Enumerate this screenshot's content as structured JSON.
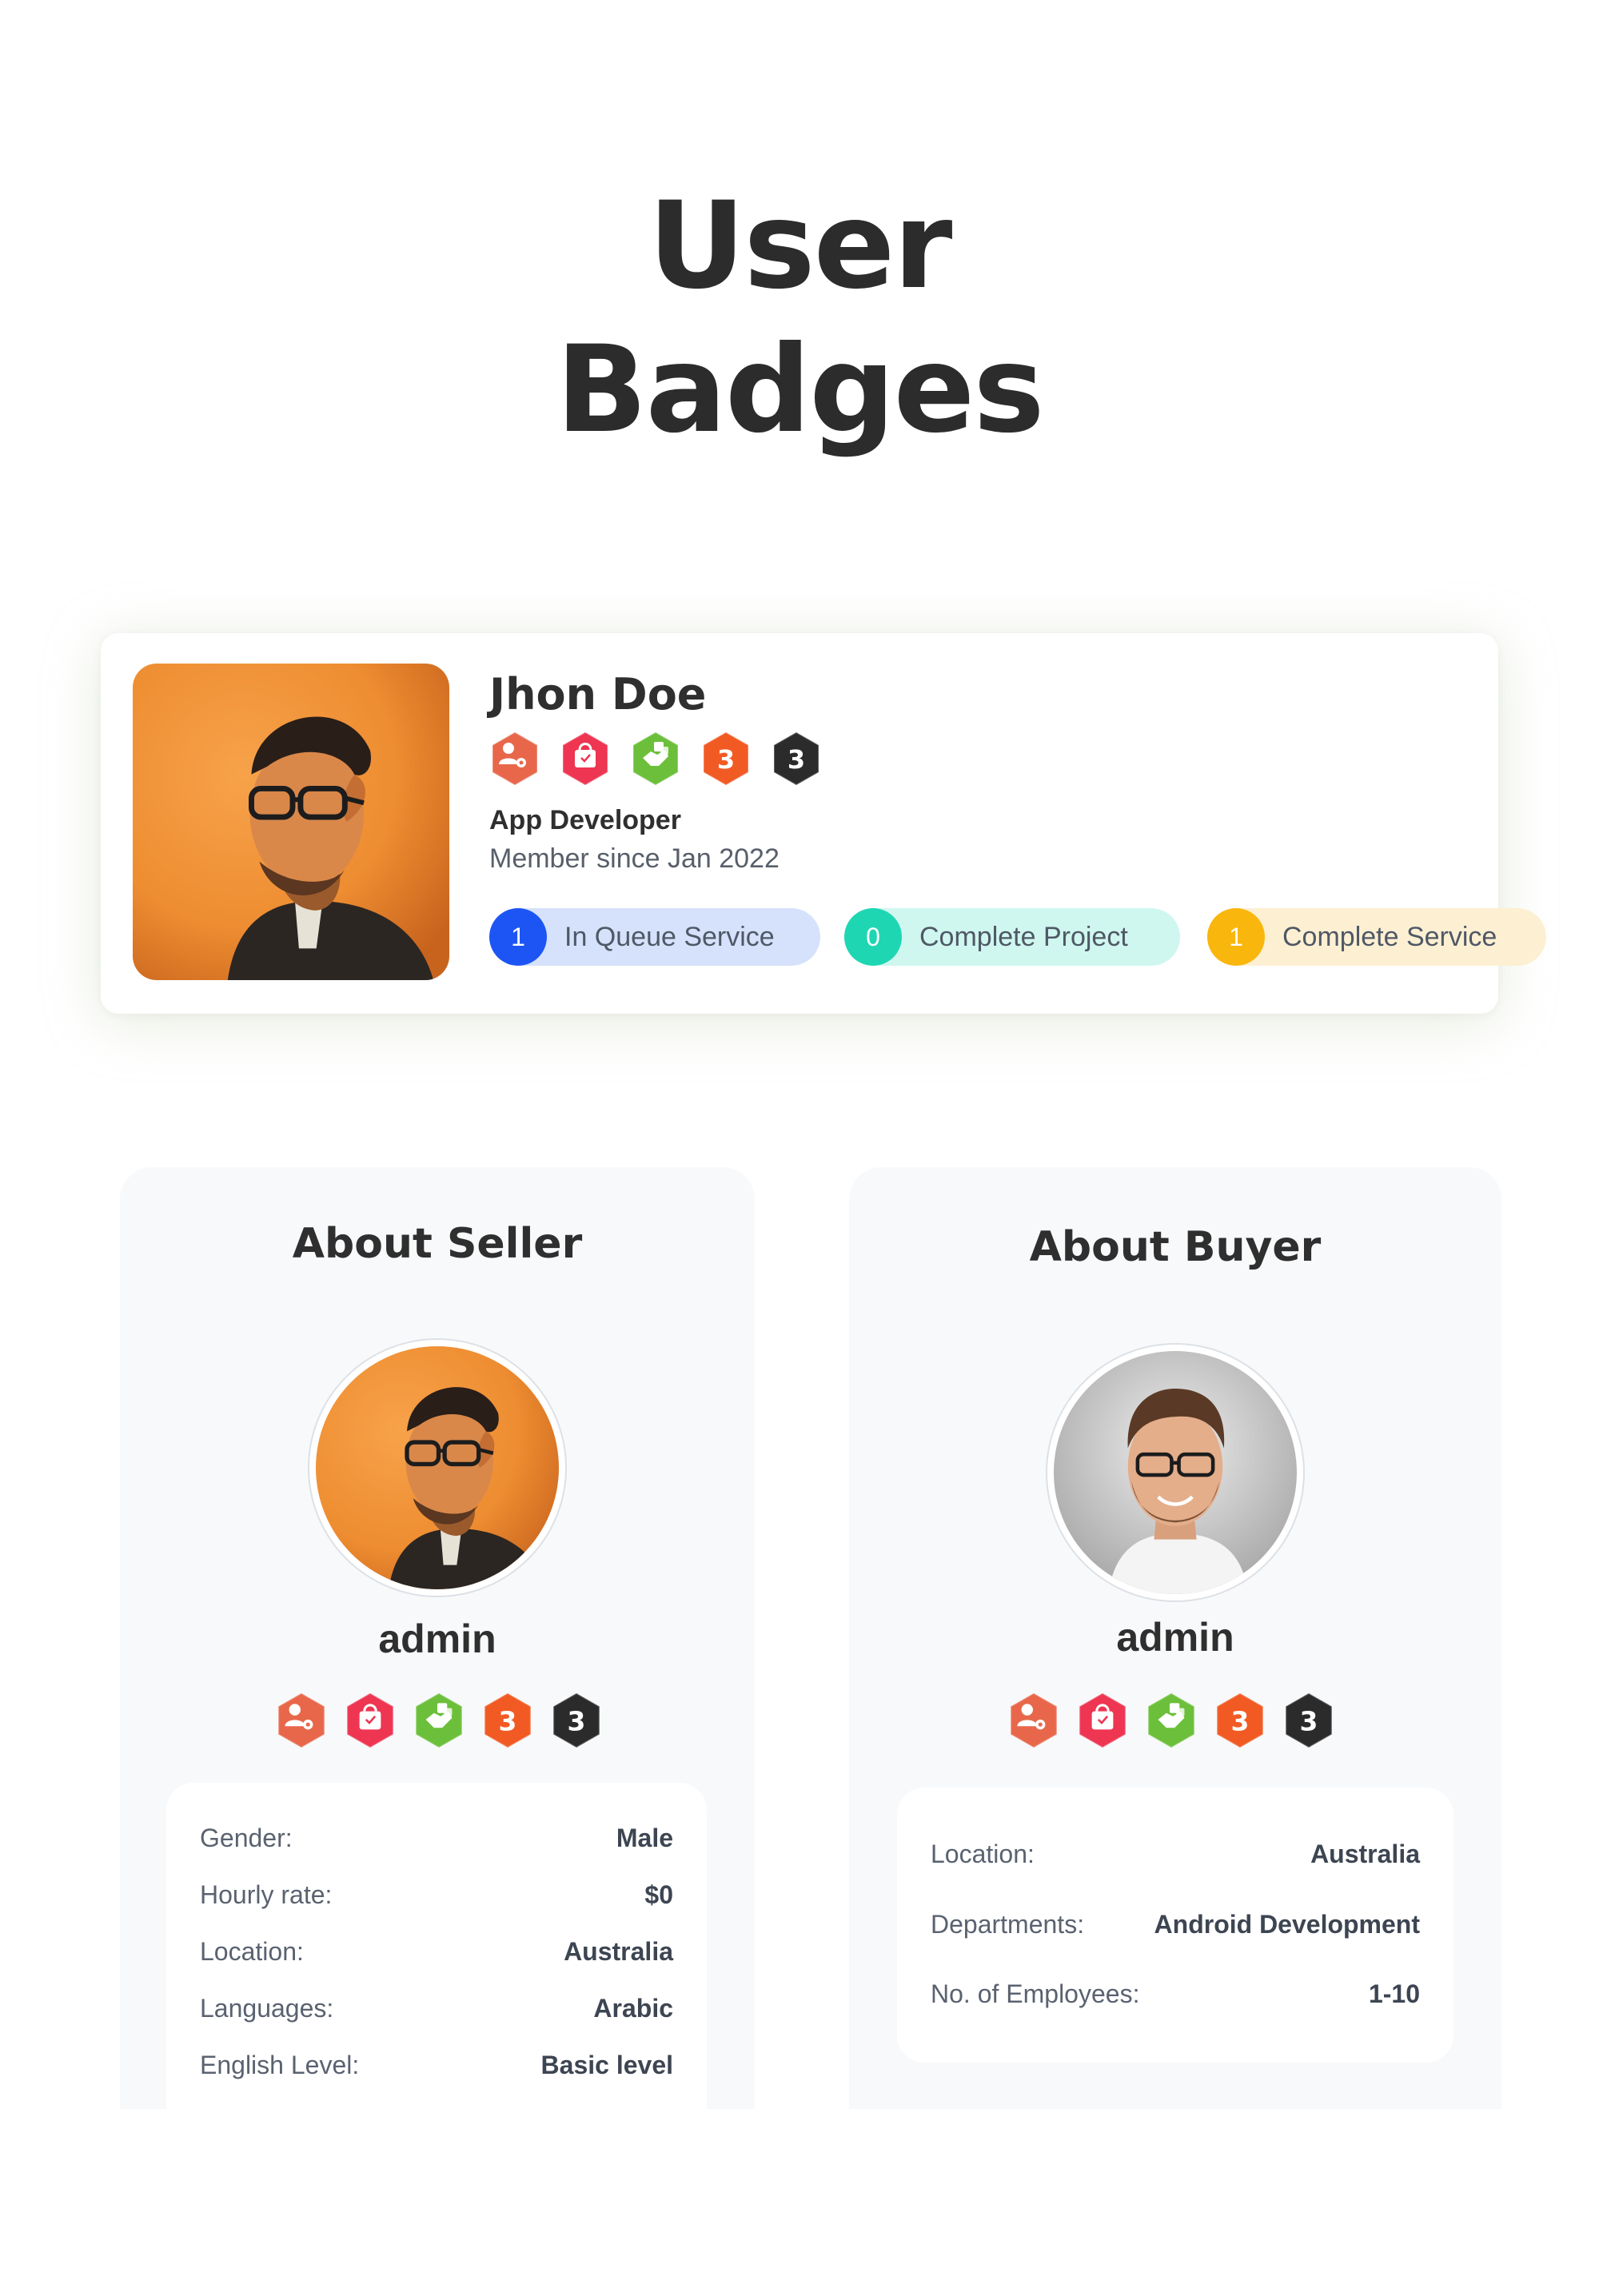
{
  "page": {
    "title_line1": "User",
    "title_line2": "Badges"
  },
  "badges": [
    {
      "icon": "user-settings-icon",
      "color": "#e8674a",
      "label": ""
    },
    {
      "icon": "shopping-bag-icon",
      "color": "#ee3552",
      "label": ""
    },
    {
      "icon": "handshake-icon",
      "color": "#6cbf3a",
      "label": ""
    },
    {
      "icon": "number-badge-icon",
      "color": "#f25a24",
      "label": "3"
    },
    {
      "icon": "number-badge-icon",
      "color": "#2b2b2b",
      "label": "3"
    }
  ],
  "profile": {
    "name": "Jhon Doe",
    "role": "App Developer",
    "member_since": "Member since Jan 2022",
    "stats": [
      {
        "count": "1",
        "label": "In Queue Service",
        "count_color": "#1d55f5",
        "bg_color": "#d6e2fb"
      },
      {
        "count": "0",
        "label": "Complete Project",
        "count_color": "#1fd6b3",
        "bg_color": "#cff7ef"
      },
      {
        "count": "1",
        "label": "Complete Service",
        "count_color": "#f9b60c",
        "bg_color": "#fdf0d2"
      }
    ]
  },
  "seller": {
    "title": "About Seller",
    "name": "admin",
    "details": [
      {
        "key": "Gender:",
        "value": "Male"
      },
      {
        "key": "Hourly rate:",
        "value": "$0"
      },
      {
        "key": "Location:",
        "value": "Australia"
      },
      {
        "key": "Languages:",
        "value": "Arabic"
      },
      {
        "key": "English Level:",
        "value": "Basic level"
      }
    ]
  },
  "buyer": {
    "title": "About Buyer",
    "name": "admin",
    "details": [
      {
        "key": "Location:",
        "value": "Australia"
      },
      {
        "key": "Departments:",
        "value": "Android Development"
      },
      {
        "key": "No. of Employees:",
        "value": "1-10"
      }
    ]
  }
}
